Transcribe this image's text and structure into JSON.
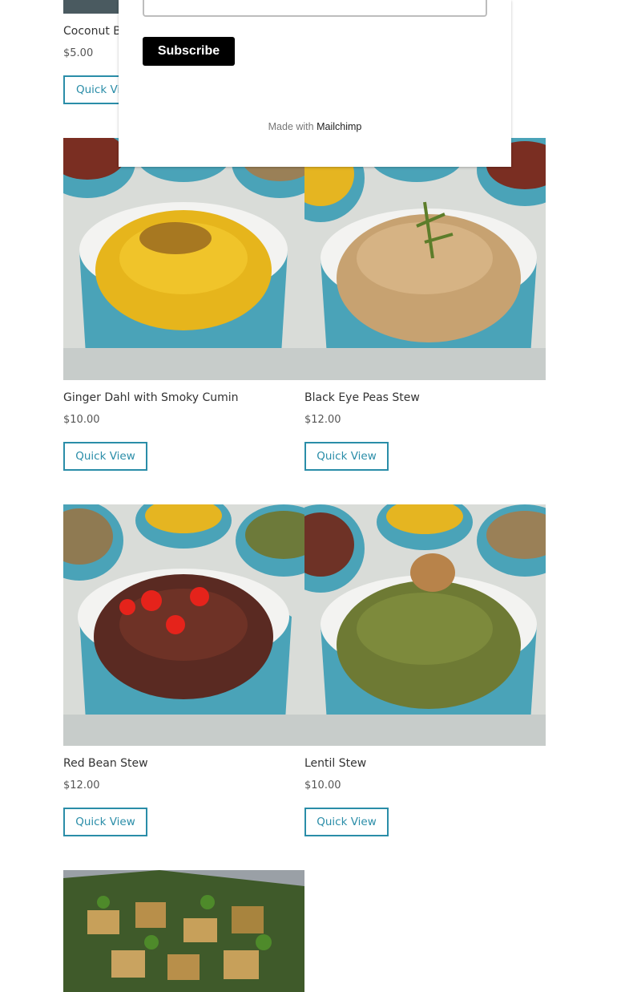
{
  "popup": {
    "subscribe_label": "Subscribe",
    "made_with_prefix": "Made with",
    "made_with_brand": "Mailchimp"
  },
  "products": [
    {
      "name": "Coconut B",
      "price": "$5.00",
      "button": "Quick Vi"
    },
    {
      "name": "Ginger Dahl with Smoky Cumin",
      "price": "$10.00",
      "button": "Quick View"
    },
    {
      "name": "Black Eye Peas Stew",
      "price": "$12.00",
      "button": "Quick View"
    },
    {
      "name": "Red Bean Stew",
      "price": "$12.00",
      "button": "Quick View"
    },
    {
      "name": "Lentil Stew",
      "price": "$10.00",
      "button": "Quick View"
    }
  ]
}
